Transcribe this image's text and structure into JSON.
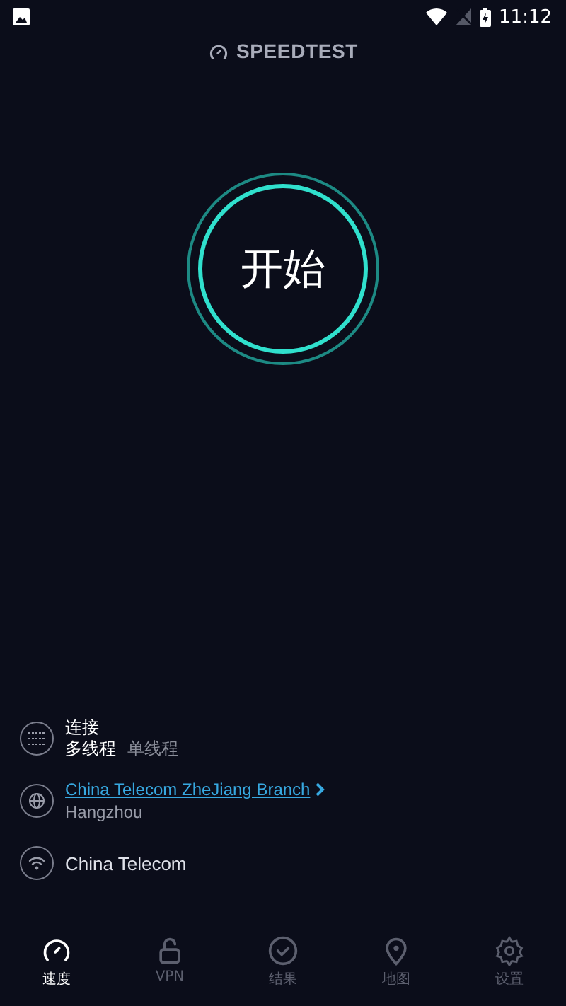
{
  "status_bar": {
    "time": "11:12"
  },
  "header": {
    "title": "SPEEDTEST"
  },
  "start_button": {
    "label": "开始"
  },
  "connection": {
    "label": "连接",
    "modes": [
      {
        "label": "多线程",
        "selected": true
      },
      {
        "label": "单线程",
        "selected": false
      }
    ]
  },
  "server": {
    "name": "China Telecom ZheJiang Branch",
    "location": "Hangzhou"
  },
  "provider": {
    "name": "China Telecom"
  },
  "nav": [
    {
      "kind": "speed",
      "label": "速度",
      "selected": true
    },
    {
      "kind": "vpn",
      "label": "VPN",
      "selected": false
    },
    {
      "kind": "results",
      "label": "结果",
      "selected": false
    },
    {
      "kind": "map",
      "label": "地图",
      "selected": false
    },
    {
      "kind": "settings",
      "label": "设置",
      "selected": false
    }
  ]
}
